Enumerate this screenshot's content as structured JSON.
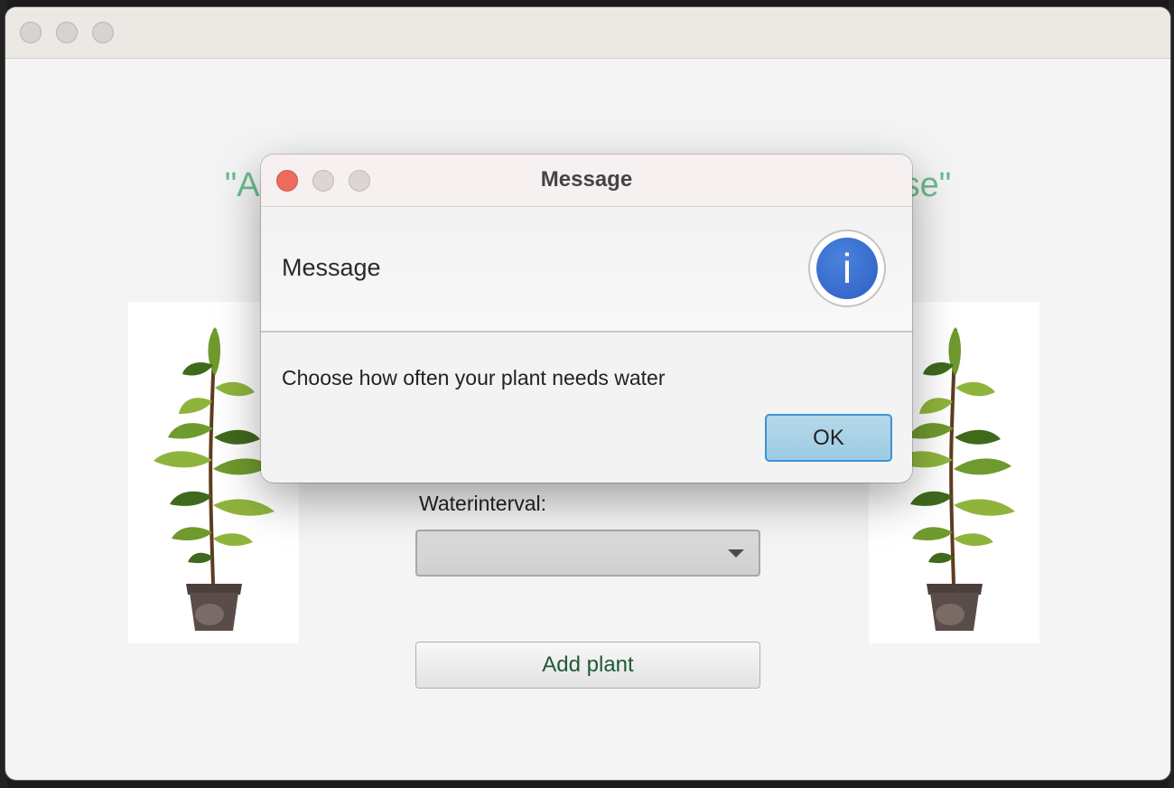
{
  "main_window": {
    "headline": "\"A beautiful plant brightens up the whole house\"",
    "water_label": "Waterinterval:",
    "water_select_value": "",
    "add_button_label": "Add plant"
  },
  "dialog": {
    "title": "Message",
    "header_text": "Message",
    "body_text": "Choose how often your plant needs water",
    "ok_label": "OK",
    "icon_glyph": "i",
    "icon_name": "info-icon"
  },
  "colors": {
    "headline": "#6cbc8c",
    "add_button_text": "#1f5a34",
    "ok_button": "#a9d2e6",
    "info_icon": "#3a6fd2",
    "close_button": "#ec6a5e"
  }
}
